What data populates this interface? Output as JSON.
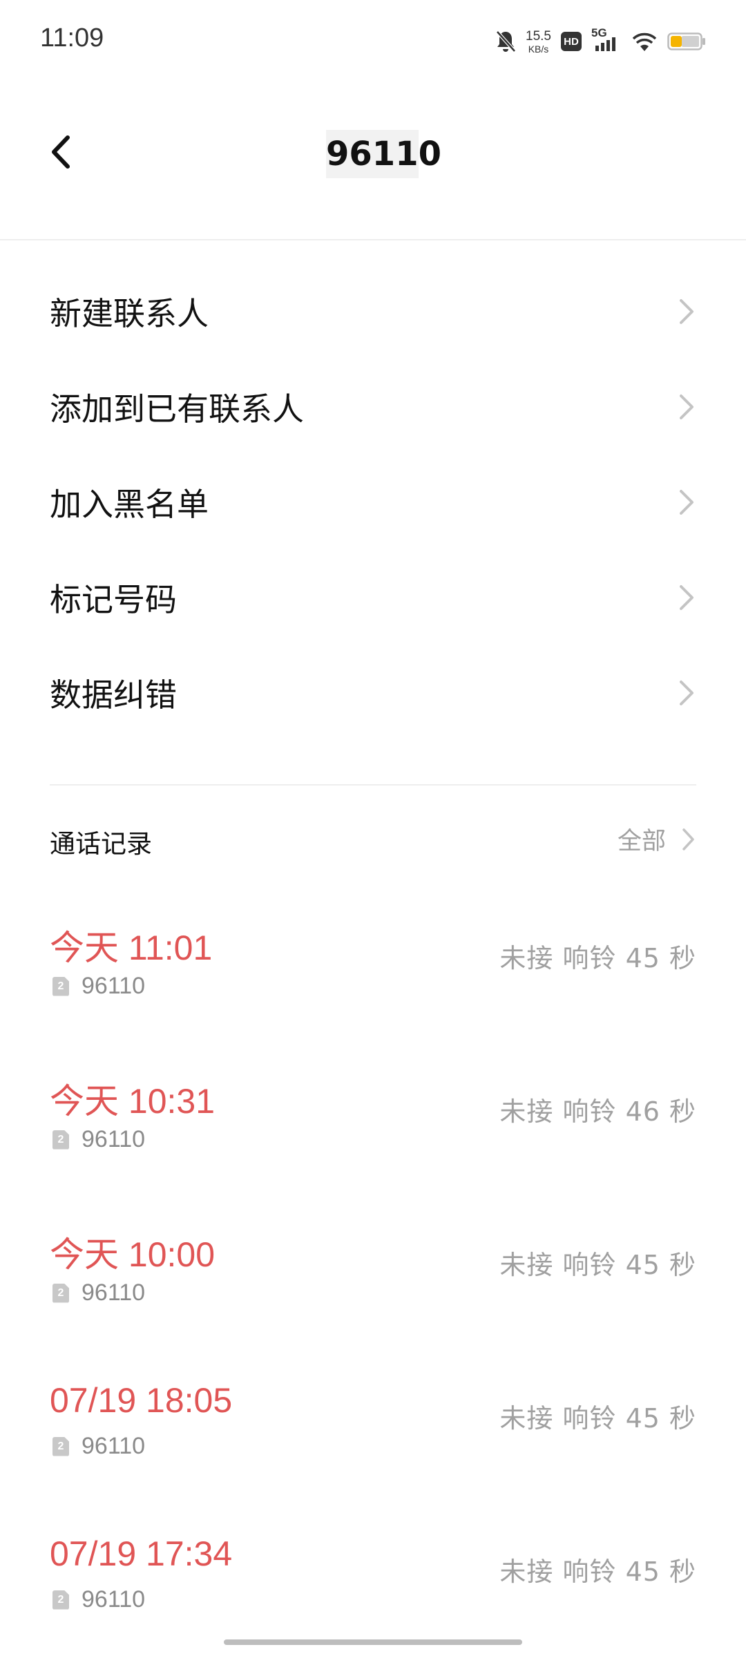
{
  "status_bar": {
    "time": "11:09",
    "net_speed": "15.5",
    "net_unit": "KB/s",
    "hd_label": "HD",
    "network_label": "5G",
    "icons": [
      "bell-muted-icon",
      "hd-icon",
      "signal-icon",
      "wifi-icon",
      "battery-icon"
    ],
    "battery_color": "#f5b400"
  },
  "header": {
    "title": "96110",
    "back_icon": "chevron-left-icon"
  },
  "menu": {
    "items": [
      {
        "label": "新建联系人"
      },
      {
        "label": "添加到已有联系人"
      },
      {
        "label": "加入黑名单"
      },
      {
        "label": "标记号码"
      },
      {
        "label": "数据纠错"
      }
    ]
  },
  "call_log": {
    "title": "通话记录",
    "all_label": "全部",
    "records": [
      {
        "time": "今天 11:01",
        "sim": "2",
        "number": "96110",
        "status": "未接 响铃 45 秒"
      },
      {
        "time": "今天 10:31",
        "sim": "2",
        "number": "96110",
        "status": "未接 响铃 46 秒"
      },
      {
        "time": "今天 10:00",
        "sim": "2",
        "number": "96110",
        "status": "未接 响铃 45 秒"
      },
      {
        "time": "07/19 18:05",
        "sim": "2",
        "number": "96110",
        "status": "未接 响铃 45 秒"
      },
      {
        "time": "07/19 17:34",
        "sim": "2",
        "number": "96110",
        "status": "未接 响铃 45 秒"
      }
    ]
  },
  "colors": {
    "missed_call": "#e05555",
    "secondary_text": "#a0a0a0"
  }
}
